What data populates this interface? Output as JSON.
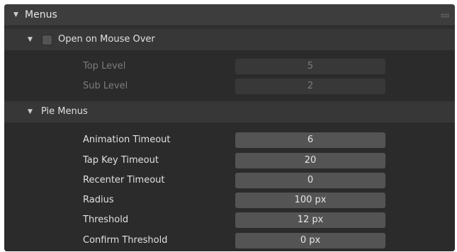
{
  "menus_panel": {
    "title": "Menus"
  },
  "open_on_mouse_over": {
    "label": "Open on Mouse Over",
    "checked": false,
    "fields": [
      {
        "label": "Top Level",
        "value": "5",
        "enabled": false
      },
      {
        "label": "Sub Level",
        "value": "2",
        "enabled": false
      }
    ]
  },
  "pie_menus": {
    "title": "Pie Menus",
    "fields": [
      {
        "label": "Animation Timeout",
        "value": "6"
      },
      {
        "label": "Tap Key Timeout",
        "value": "20"
      },
      {
        "label": "Recenter Timeout",
        "value": "0"
      },
      {
        "label": "Radius",
        "value": "100 px"
      },
      {
        "label": "Threshold",
        "value": "12 px"
      },
      {
        "label": "Confirm Threshold",
        "value": "0 px"
      }
    ]
  },
  "icons": {
    "expand": "disclosure-triangle-down-icon",
    "drag": "drag-grip-icon"
  },
  "colors": {
    "panel_background": "#303030",
    "header_background": "#3d3d3d",
    "field_background": "#545454",
    "disabled_text": "#7c7c7c"
  }
}
